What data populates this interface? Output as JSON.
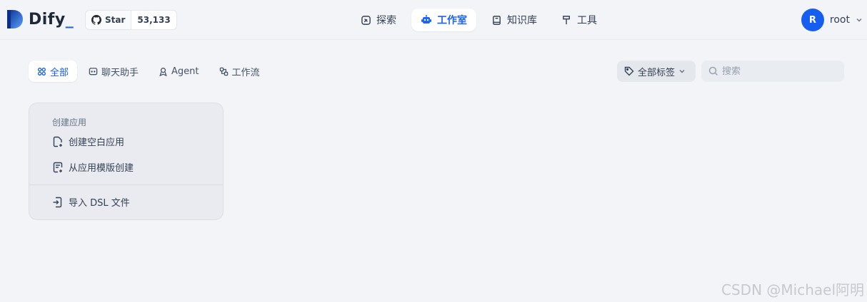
{
  "app": {
    "name": "Dify",
    "cursor": "_"
  },
  "github": {
    "label": "Star",
    "count": "53,133"
  },
  "nav": [
    {
      "label": "探索",
      "icon": "explore-icon"
    },
    {
      "label": "工作室",
      "icon": "robot-icon",
      "active": true
    },
    {
      "label": "知识库",
      "icon": "book-icon"
    },
    {
      "label": "工具",
      "icon": "hammer-icon"
    }
  ],
  "user": {
    "initial": "R",
    "name": "root"
  },
  "filters": [
    {
      "label": "全部",
      "icon": "grid-icon",
      "active": true
    },
    {
      "label": "聊天助手",
      "icon": "chat-icon"
    },
    {
      "label": "Agent",
      "icon": "agent-icon"
    },
    {
      "label": "工作流",
      "icon": "workflow-icon"
    }
  ],
  "tags": {
    "label": "全部标签"
  },
  "search": {
    "placeholder": "搜索"
  },
  "create_card": {
    "title": "创建应用",
    "blank": "创建空白应用",
    "template": "从应用模版创建",
    "import": "导入 DSL 文件"
  },
  "watermark": "CSDN @Michael阿明",
  "colors": {
    "accent": "#155eef",
    "background": "#f2f4f7"
  }
}
